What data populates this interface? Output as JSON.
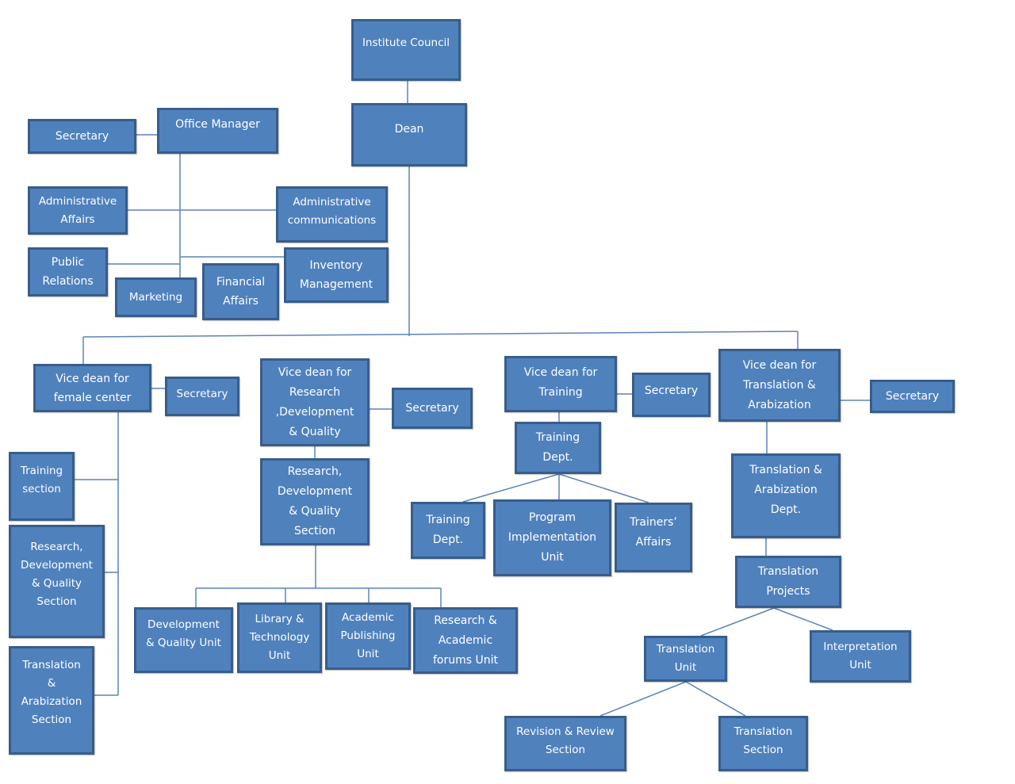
{
  "colors": {
    "box_fill": "#4f81bd",
    "box_border": "#385d8a",
    "connector": "#5b84b8"
  },
  "nodes": {
    "institute_council": "Institute Council",
    "dean": "Dean",
    "office_manager": "Office Manager",
    "office_secretary": "Secretary",
    "administrative_affairs": "Administrative\nAffairs",
    "administrative_communications": "Administrative\ncommunications",
    "public_relations": "Public\nRelations",
    "marketing": "Marketing",
    "financial_affairs": "Financial\nAffairs",
    "inventory_management": "Inventory\nManagement",
    "vd_female": "Vice dean for\nfemale center",
    "vd_female_secretary": "Secretary",
    "female_training_section": "Training\nsection",
    "female_rdq_section": "Research,\nDevelopment\n& Quality\nSection",
    "female_translation_section": "Translation\n&\nArabization\nSection",
    "vd_research": "Vice dean for\nResearch\n,Development\n& Quality",
    "vd_research_secretary": "Secretary",
    "rdq_section": "Research,\nDevelopment\n& Quality\nSection",
    "dev_quality_unit": "Development\n& Quality Unit",
    "library_tech_unit": "Library  &\nTechnology\nUnit",
    "academic_publishing_unit": "Academic\nPublishing\nUnit",
    "research_forums_unit": "Research &\nAcademic\nforums Unit",
    "vd_training": "Vice dean for\nTraining",
    "vd_training_secretary": "Secretary",
    "training_dept_main": "Training\nDept.",
    "training_dept_sub": "Training\nDept.",
    "program_implementation_unit": "Program\nImplementation\nUnit",
    "trainers_affairs": "Trainers’\nAffairs",
    "vd_translation": "Vice dean for\nTranslation &\nArabization",
    "vd_translation_secretary": "Secretary",
    "translation_arabization_dept": "Translation &\nArabization\nDept.",
    "translation_projects": "Translation\nProjects",
    "interpretation_unit": "Interpretation\nUnit",
    "translation_unit": "Translation\nUnit",
    "revision_review_section": "Revision & Review\nSection",
    "translation_section": "Translation\nSection"
  }
}
